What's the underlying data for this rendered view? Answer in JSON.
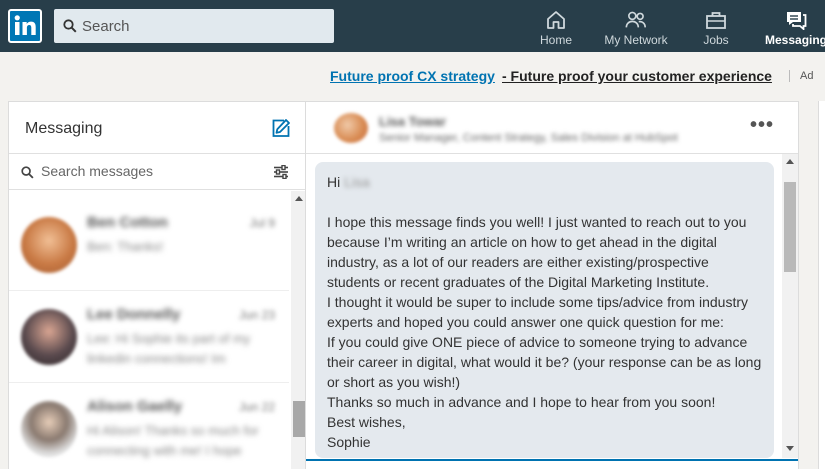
{
  "nav": {
    "search_placeholder": "Search",
    "items": [
      {
        "label": "Home",
        "icon": "home-icon"
      },
      {
        "label": "My Network",
        "icon": "network-icon"
      },
      {
        "label": "Jobs",
        "icon": "briefcase-icon"
      },
      {
        "label": "Messaging",
        "icon": "messaging-icon",
        "active": true
      }
    ]
  },
  "ad": {
    "link_text": "Future proof CX strategy",
    "tagline": "- Future proof your customer experience",
    "label": "Ad"
  },
  "messaging": {
    "title": "Messaging",
    "search_placeholder": "Search messages",
    "conversations": [
      {
        "name": "Ben Cotton",
        "date": "Jul 9",
        "preview": "Ben: Thanks!",
        "avatar_color": "#c97a45"
      },
      {
        "name": "Lee Donnelly",
        "date": "Jun 23",
        "preview": "Lee: Hi Sophie its part of my linkedin connections! Im",
        "avatar_color": "#5a4a4e"
      },
      {
        "name": "Alison Gaelly",
        "date": "Jun 22",
        "preview": "Hi Alison! Thanks so much for connecting with me! I hope",
        "avatar_color": "#8a7a70"
      }
    ]
  },
  "thread": {
    "contact_name": "Lisa Towar",
    "contact_title": "Senior Manager, Content Strategy, Sales Division at HubSpot",
    "message": {
      "greeting": "Hi",
      "greeting_name": "Lisa",
      "paragraph": "I hope this message finds you well! I just wanted to reach out to you because I’m writing an article on how to get ahead in the digital industry, as a lot of our readers are either existing/prospective students or recent graduates of the Digital Marketing Institute.",
      "line2": "I thought it would be super to include some tips/advice from industry experts and hoped you could answer one quick question for me:",
      "line3": "If you could give ONE piece of advice to someone trying to advance their career in digital, what would it be? (your response can be as long or short as you wish!)",
      "line4": "Thanks so much in advance and I hope to hear from you soon!",
      "closing": "Best wishes,",
      "signature": "Sophie"
    }
  },
  "colors": {
    "nav_bg": "#283e4a",
    "brand_blue": "#0077b5",
    "link_blue": "#0073b1",
    "bubble_bg": "#e4e9ee"
  }
}
